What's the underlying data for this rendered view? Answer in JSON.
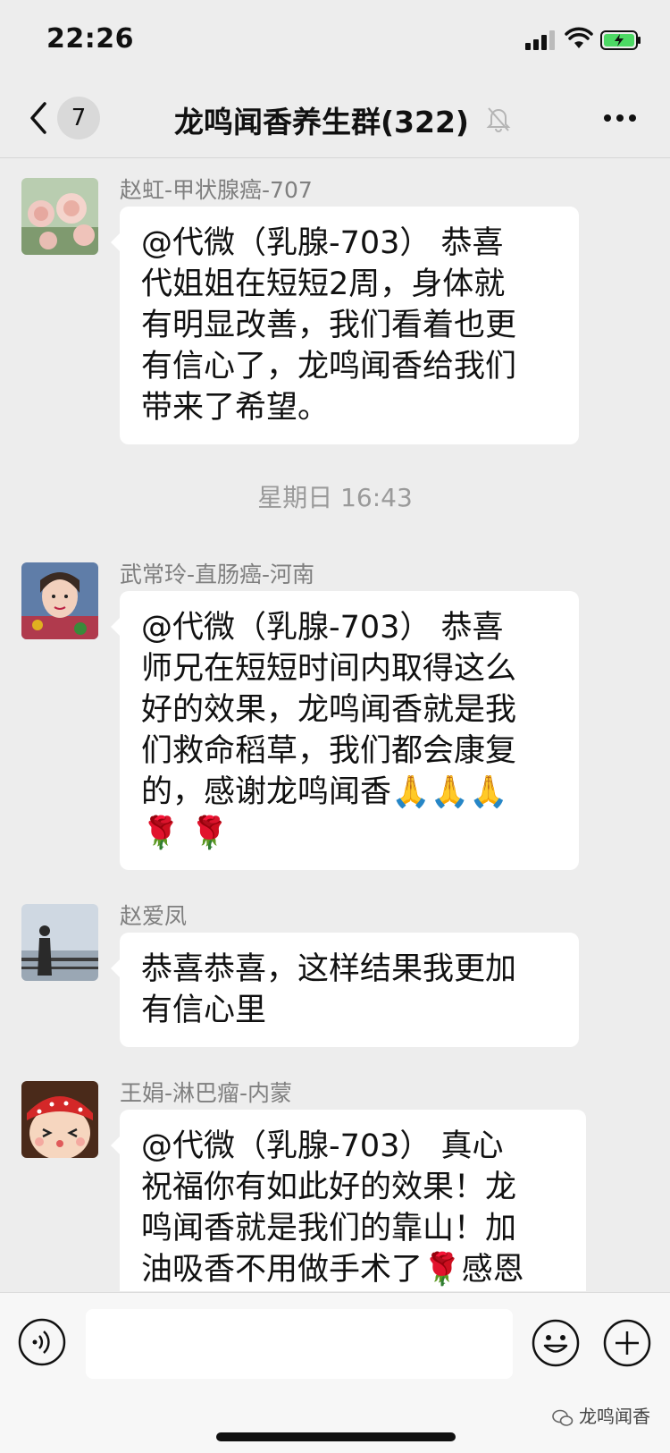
{
  "status_bar": {
    "time": "22:26"
  },
  "header": {
    "back_count": "7",
    "title": "龙鸣闻香养生群(322)"
  },
  "messages": [
    {
      "sender": "赵虹-甲状腺癌-707",
      "lines": [
        "@代微（乳腺-703） 恭喜",
        "代姐姐在短短2周，身体就",
        "有明显改善，我们看着也更",
        "有信心了，龙鸣闻香给我们",
        "带来了希望。"
      ]
    },
    {
      "sender": "武常玲-直肠癌-河南",
      "lines": [
        "@代微（乳腺-703） 恭喜",
        "师兄在短短时间内取得这么",
        "好的效果，龙鸣闻香就是我",
        "们救命稻草，我们都会康复",
        "的，感谢龙鸣闻香🙏🙏🙏",
        "🌹 🌹"
      ]
    },
    {
      "sender": "赵爱凤",
      "lines": [
        "恭喜恭喜，这样结果我更加",
        "有信心里"
      ]
    },
    {
      "sender": "王娟-淋巴瘤-内蒙",
      "lines": [
        "@代微（乳腺-703） 真心",
        "祝福你有如此好的效果！龙",
        "鸣闻香就是我们的靠山！加",
        "油吸香不用做手术了🌹感恩"
      ]
    }
  ],
  "timestamp": "星期日 16:43",
  "watermark": "龙鸣闻香",
  "icons": {
    "back": "chevron-left-icon",
    "mute": "bell-muted-icon",
    "more": "more-dots-icon",
    "voice": "voice-icon",
    "emoji": "emoji-icon",
    "plus": "plus-icon"
  }
}
